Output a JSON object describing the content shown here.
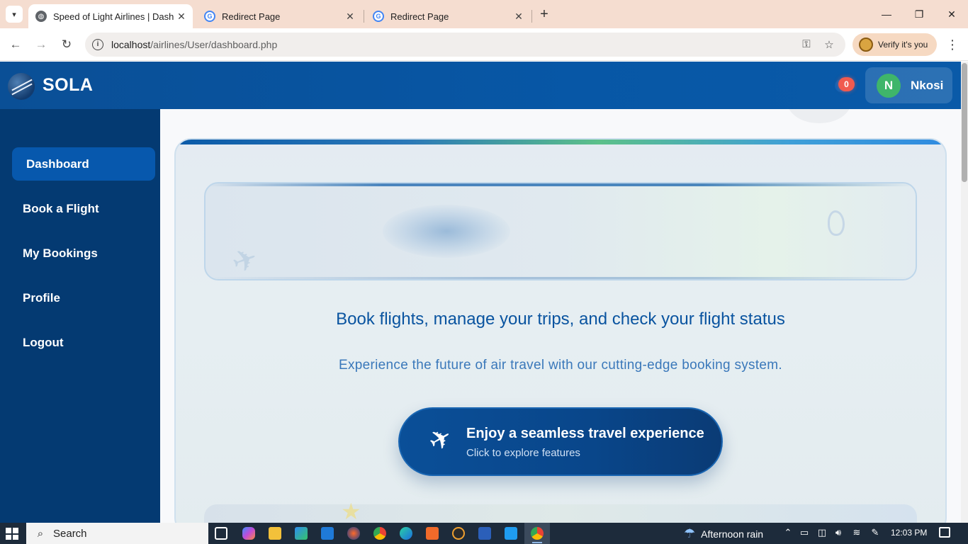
{
  "browser": {
    "tabs": [
      {
        "title": "Speed of Light Airlines | Dashboard",
        "active": true,
        "favicon": "globe-icon"
      },
      {
        "title": "Redirect Page",
        "active": false,
        "favicon": "google-icon"
      },
      {
        "title": "Redirect Page",
        "active": false,
        "favicon": "google-icon"
      }
    ],
    "url_host": "localhost",
    "url_path": "/airlines/User/dashboard.php",
    "profile_label": "Verify it's you"
  },
  "header": {
    "brand": "SOLA",
    "notification_count": "0",
    "user_initial": "N",
    "user_name": "Nkosi"
  },
  "sidebar": {
    "items": [
      {
        "label": "Dashboard",
        "active": true
      },
      {
        "label": "Book a Flight",
        "active": false
      },
      {
        "label": "My Bookings",
        "active": false
      },
      {
        "label": "Profile",
        "active": false
      },
      {
        "label": "Logout",
        "active": false
      }
    ]
  },
  "main": {
    "headline": "Book flights, manage your trips, and check your flight status",
    "subline": "Experience the future of air travel with our cutting-edge booking system.",
    "cta_title": "Enjoy a seamless travel experience",
    "cta_subtitle": "Click to explore features"
  },
  "taskbar": {
    "search_label": "Search",
    "weather": "Afternoon rain",
    "time": "12:03 PM"
  },
  "colors": {
    "header_bg": "#0757a6",
    "sidebar_bg": "#043a72",
    "sidebar_active": "#0758ad",
    "headline": "#0a54a0",
    "cta_bg": "#09468a",
    "badge": "#f05a4f",
    "avatar": "#3fb56a"
  }
}
